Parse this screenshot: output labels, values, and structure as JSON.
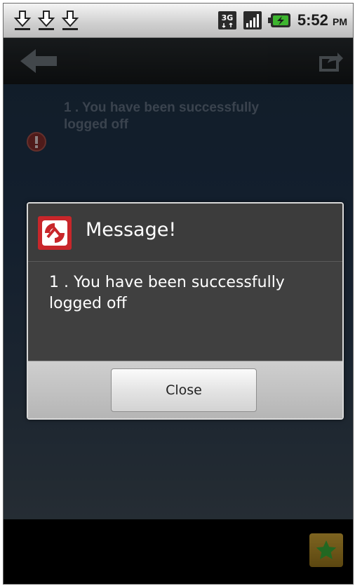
{
  "status_bar": {
    "download_icons": [
      "download-icon",
      "download-icon",
      "download-icon"
    ],
    "network_label": "3G",
    "signal_icon": "signal-bars-icon",
    "battery_icon": "battery-charging-icon",
    "time": "5:52",
    "ampm": "PM"
  },
  "app_bar": {
    "back_icon": "back-arrow-icon",
    "share_icon": "share-icon"
  },
  "messages": [
    {
      "text": "1 . You have been successfully logged off",
      "icon": "alert-icon"
    }
  ],
  "dialog": {
    "title": "Message!",
    "body": "1 . You have been successfully logged off",
    "button_label": "Close",
    "logo_icon": "app-logo-icon"
  },
  "bottom_bar": {
    "star_icon": "star-icon"
  },
  "colors": {
    "dialog_bg": "#404040",
    "star_green": "#2e8b2e",
    "alert_red": "#c0392b"
  }
}
